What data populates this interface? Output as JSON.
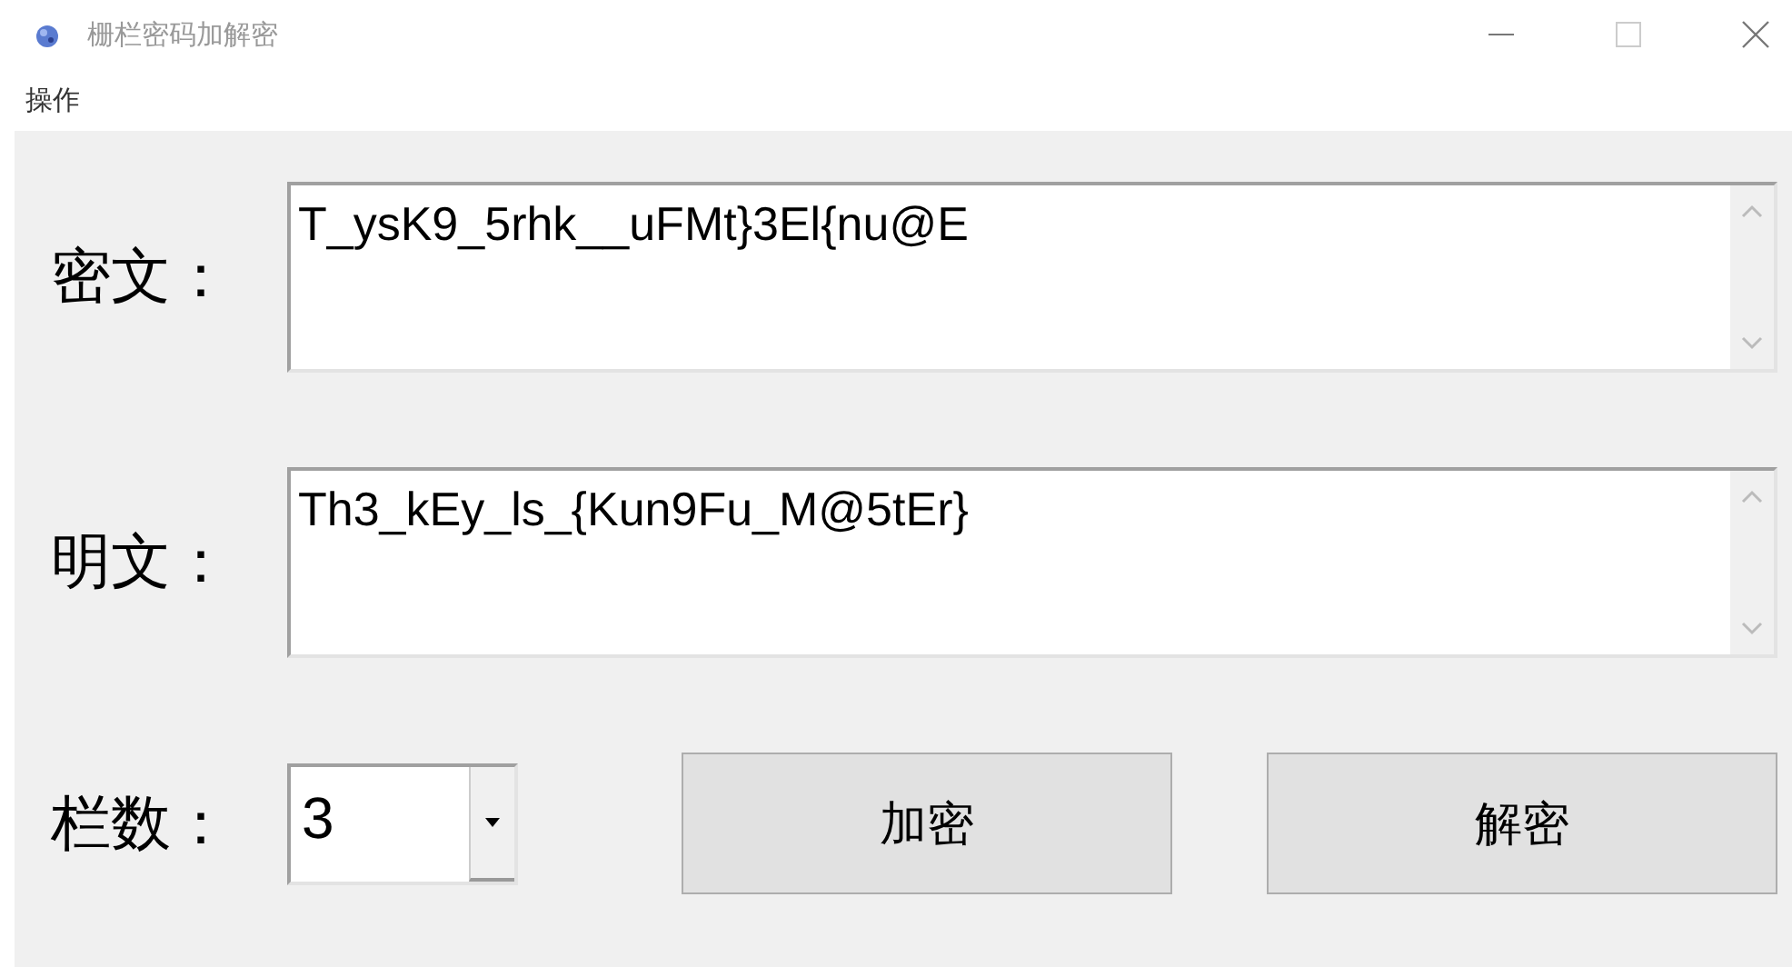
{
  "window": {
    "title": "栅栏密码加解密"
  },
  "menu": [
    {
      "label": "操作"
    }
  ],
  "fields": [
    {
      "label": "密文：",
      "value": "T_ysK9_5rhk__uFMt}3El{nu@E"
    },
    {
      "label": "明文：",
      "value": "Th3_kEy_ls_{Kun9Fu_M@5tEr}"
    }
  ],
  "rails": {
    "label": "栏数：",
    "value": "3"
  },
  "buttons": [
    {
      "label": "加密"
    },
    {
      "label": "解密"
    }
  ]
}
